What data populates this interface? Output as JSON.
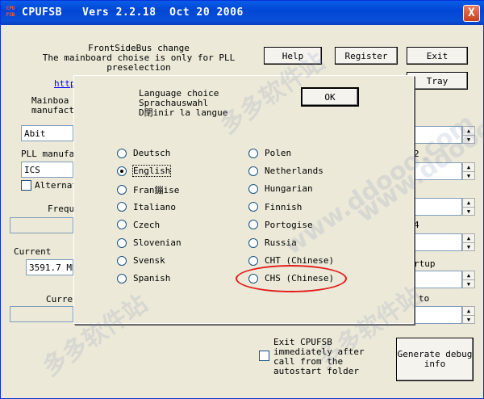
{
  "window": {
    "app_icon_text": "CPU\nFSB",
    "title": "CPUFSB   Vers 2.2.18  Oct 20 2006",
    "close_label": "X"
  },
  "main": {
    "header_text": "FrontSideBus change\nThe mainboard choise is only for PLL\npreselection",
    "link_text": "http",
    "mainboard_label": "Mainboa\nmanufactu",
    "mainboard_value": "Abit",
    "pll_label": "PLL manufac",
    "pll_value": "ICS",
    "alternate_label": "Alternat",
    "freq_label": "Frequ",
    "current_label": "Current",
    "current_value": "3591.7 MH",
    "current2_label": "Curren",
    "right_label_2": "2",
    "right_label_4": "4",
    "right_label_rtup": "rtup",
    "right_label_to": "to",
    "buttons": {
      "help": "Help",
      "register": "Register",
      "exit": "Exit",
      "tray": "Tray",
      "generate_debug": "Generate debug\ninfo"
    },
    "exit_option_label": "Exit CPUFSB\nimmediately after\ncall from the\nautostart folder"
  },
  "dialog": {
    "heading": "Language choice\nSprachauswahl\nD閉inir la langue",
    "ok_label": "OK",
    "languages_left": [
      {
        "label": "Deutsch",
        "selected": false
      },
      {
        "label": "English",
        "selected": true
      },
      {
        "label": "Fran鏰ise",
        "selected": false
      },
      {
        "label": "Italiano",
        "selected": false
      },
      {
        "label": "Czech",
        "selected": false
      },
      {
        "label": "Slovenian",
        "selected": false
      },
      {
        "label": "Svensk",
        "selected": false
      },
      {
        "label": "Spanish",
        "selected": false
      }
    ],
    "languages_right": [
      {
        "label": "Polen",
        "selected": false
      },
      {
        "label": "Netherlands",
        "selected": false
      },
      {
        "label": "Hungarian",
        "selected": false
      },
      {
        "label": "Finnish",
        "selected": false
      },
      {
        "label": "Portogise",
        "selected": false
      },
      {
        "label": "Russia",
        "selected": false
      },
      {
        "label": "CHT (Chinese)",
        "selected": false
      },
      {
        "label": "CHS (Chinese)",
        "selected": false
      }
    ]
  },
  "watermarks": [
    "多多软件站",
    "www.ddooo.com",
    "多多软件站",
    "www.ddooo.com",
    "多多软件站"
  ],
  "colors": {
    "titlebar": "#0a4fd8",
    "window_bg": "#ece9d8",
    "highlight": "#e21c1c"
  }
}
